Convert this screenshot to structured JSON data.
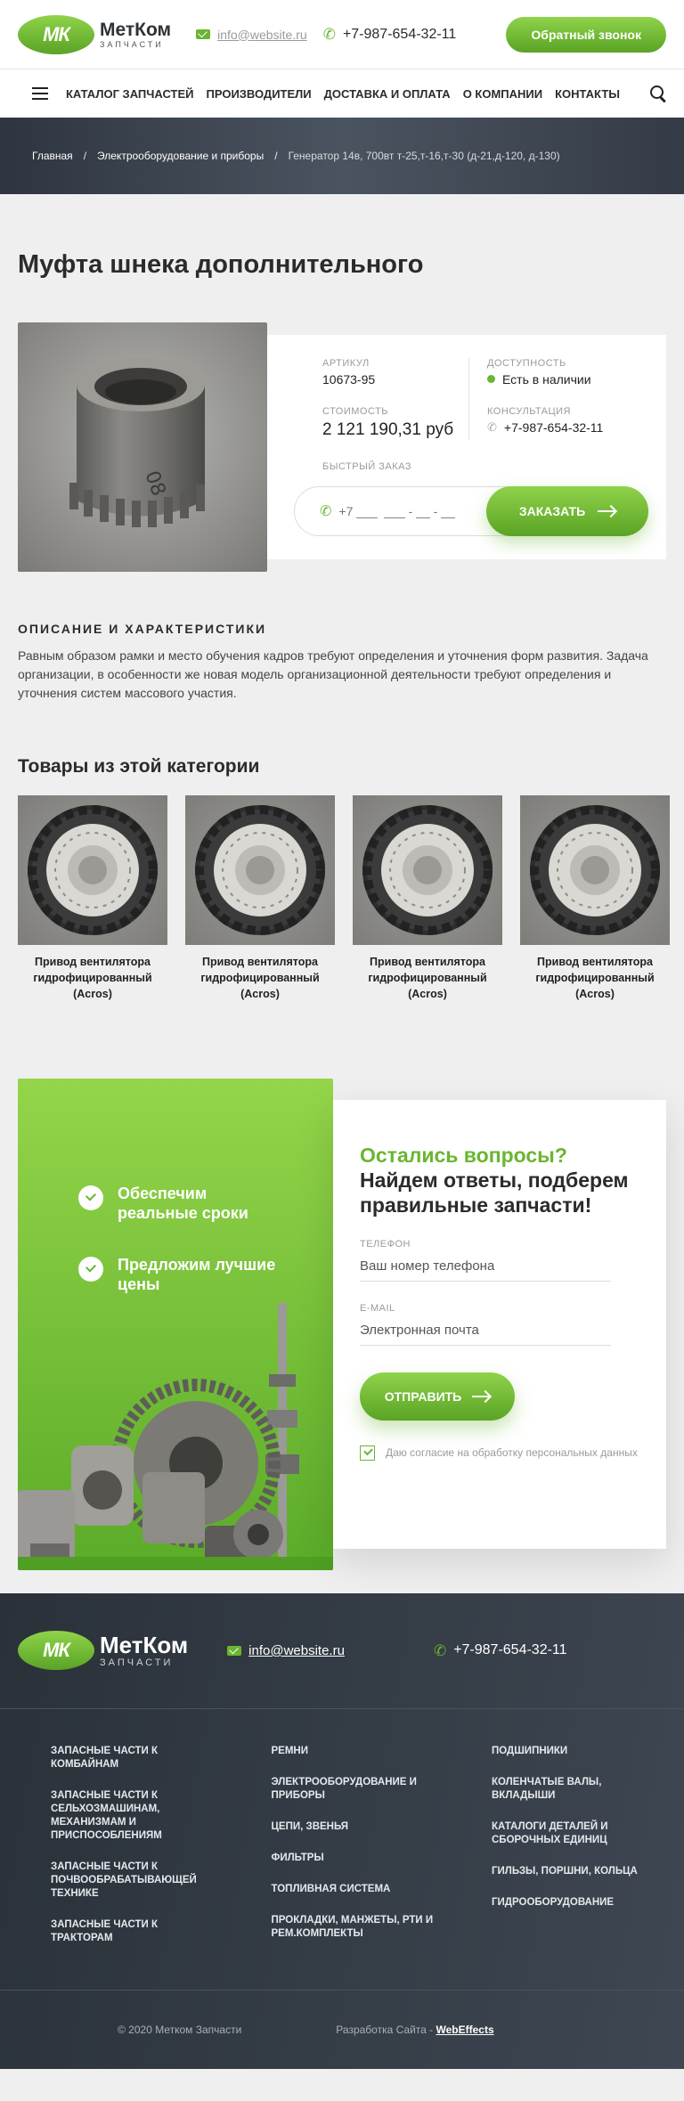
{
  "header": {
    "logo_mark": "МК",
    "logo_name": "МетКом",
    "logo_sub": "ЗАПЧАСТИ",
    "email": "info@website.ru",
    "phone": "+7-987-654-32-11",
    "callback": "Обратный звонок"
  },
  "nav": {
    "items": [
      "КАТАЛОГ ЗАПЧАСТЕЙ",
      "ПРОИЗВОДИТЕЛИ",
      "ДОСТАВКА И ОПЛАТА",
      "О КОМПАНИИ",
      "КОНТАКТЫ"
    ]
  },
  "breadcrumb": [
    "Главная",
    "Электрооборудование и приборы",
    "Генератор 14в, 700вт т-25,т-16,т-30 (д-21,д-120, д-130)"
  ],
  "product": {
    "title": "Муфта шнека дополнительного",
    "article_label": "АРТИКУЛ",
    "article": "10673-95",
    "availability_label": "ДОСТУПНОСТЬ",
    "availability": "Есть в наличии",
    "price_label": "СТОИМОСТЬ",
    "price": "2 121 190,31 руб",
    "consult_label": "КОНСУЛЬТАЦИЯ",
    "consult_phone": "+7-987-654-32-11",
    "quick_label": "БЫСТРЫЙ ЗАКАЗ",
    "phone_mask": "+7 ___  ___ - __ - __",
    "order_btn": "ЗАКАЗАТЬ"
  },
  "description": {
    "heading": "ОПИСАНИЕ И ХАРАКТЕРИСТИКИ",
    "text": "Равным образом рамки и место обучения кадров требуют определения и уточнения форм развития. Задача организации, в особенности же новая модель организационной деятельности требуют определения и уточнения систем массового участия."
  },
  "category": {
    "heading": "Товары из этой категории",
    "items": [
      {
        "name": "Привод вентилятора гидрофицированный (Acros)"
      },
      {
        "name": "Привод вентилятора гидрофицированный (Acros)"
      },
      {
        "name": "Привод вентилятора гидрофицированный (Acros)"
      },
      {
        "name": "Привод вентилятора гидрофицированный (Acros)"
      }
    ]
  },
  "request": {
    "benefit1": "Обеспечим реальные сроки",
    "benefit2": "Предложим лучшие цены",
    "q1": "Остались вопросы?",
    "q2": "Найдем ответы, подберем правильные запчасти!",
    "phone_label": "ТЕЛЕФОН",
    "phone_placeholder": "Ваш номер телефона",
    "email_label": "E-MAIL",
    "email_placeholder": "Электронная почта",
    "send": "ОТПРАВИТЬ",
    "agree": "Даю согласие на обработку персональных данных"
  },
  "footer": {
    "email": "info@website.ru",
    "phone": "+7-987-654-32-11",
    "col1": [
      "ЗАПАСНЫЕ ЧАСТИ К КОМБАЙНАМ",
      "ЗАПАСНЫЕ ЧАСТИ К СЕЛЬХОЗМАШИНАМ, МЕХАНИЗМАМ И ПРИСПОСОБЛЕНИЯМ",
      "ЗАПАСНЫЕ ЧАСТИ К ПОЧВООБРАБАТЫВАЮЩЕЙ ТЕХНИКЕ",
      "ЗАПАСНЫЕ ЧАСТИ К ТРАКТОРАМ"
    ],
    "col2": [
      "РЕМНИ",
      "ЭЛЕКТРООБОРУДОВАНИЕ И ПРИБОРЫ",
      "ЦЕПИ, ЗВЕНЬЯ",
      "ФИЛЬТРЫ",
      "ТОПЛИВНАЯ СИСТЕМА",
      "ПРОКЛАДКИ, МАНЖЕТЫ, РТИ И РЕМ.КОМПЛЕКТЫ"
    ],
    "col3": [
      "ПОДШИПНИКИ",
      "КОЛЕНЧАТЫЕ ВАЛЫ, ВКЛАДЫШИ",
      "КАТАЛОГИ ДЕТАЛЕЙ И СБОРОЧНЫХ ЕДИНИЦ",
      "ГИЛЬЗЫ, ПОРШНИ, КОЛЬЦА",
      "ГИДРООБОРУДОВАНИЕ"
    ],
    "copyright": "© 2020 Метком Запчасти",
    "dev_prefix": "Разработка Сайта -",
    "dev_name": "WebEffects"
  },
  "colors": {
    "accent": "#6ab531",
    "dark": "#2e3540"
  }
}
